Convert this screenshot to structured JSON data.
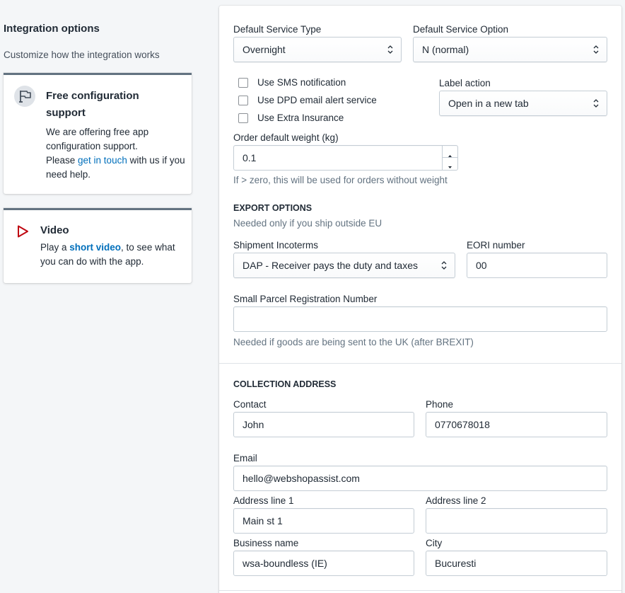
{
  "sidebar": {
    "title": "Integration options",
    "subtitle": "Customize how the integration works",
    "config_card": {
      "title": "Free configuration support",
      "text_1": "We are offering free app configuration support.",
      "text_2": "Please ",
      "link": "get in touch",
      "text_3": " with us if you need help.",
      "icon": "flag-icon"
    },
    "video_card": {
      "title": "Video",
      "text_1": "Play a ",
      "link": "short video",
      "text_2": ", to see what you can do with the app.",
      "icon": "play-icon"
    }
  },
  "settings": {
    "service_type": {
      "label": "Default Service Type",
      "value": "Overnight"
    },
    "service_option": {
      "label": "Default Service Option",
      "value": "N (normal)"
    },
    "checkboxes": [
      {
        "label": "Use SMS notification",
        "checked": false
      },
      {
        "label": "Use DPD email alert service",
        "checked": false
      },
      {
        "label": "Use Extra Insurance",
        "checked": false
      }
    ],
    "label_action": {
      "label": "Label action",
      "value": "Open in a new tab"
    },
    "weight": {
      "label": "Order default weight (kg)",
      "value": "0.1",
      "help": "If > zero, this will be used for orders without weight"
    }
  },
  "export": {
    "heading": "EXPORT OPTIONS",
    "help": "Needed only if you ship outside EU",
    "incoterms": {
      "label": "Shipment Incoterms",
      "value": "DAP - Receiver pays the duty and taxes"
    },
    "eori": {
      "label": "EORI number",
      "value": "00"
    },
    "small_parcel": {
      "label": "Small Parcel Registration Number",
      "value": "",
      "help": "Needed if goods are being sent to the UK (after BREXIT)"
    }
  },
  "collection": {
    "heading": "COLLECTION ADDRESS",
    "contact": {
      "label": "Contact",
      "value": "John"
    },
    "phone": {
      "label": "Phone",
      "value": "0770678018"
    },
    "email": {
      "label": "Email",
      "value": "hello@webshopassist.com"
    },
    "address1": {
      "label": "Address line 1",
      "value": "Main st 1"
    },
    "address2": {
      "label": "Address line 2",
      "value": ""
    },
    "business": {
      "label": "Business name",
      "value": "wsa-boundless (IE)"
    },
    "city": {
      "label": "City",
      "value": "Bucuresti"
    }
  },
  "colors": {
    "link": "#006fbb",
    "play_icon": "#bf0711",
    "card_border": "#637381"
  }
}
